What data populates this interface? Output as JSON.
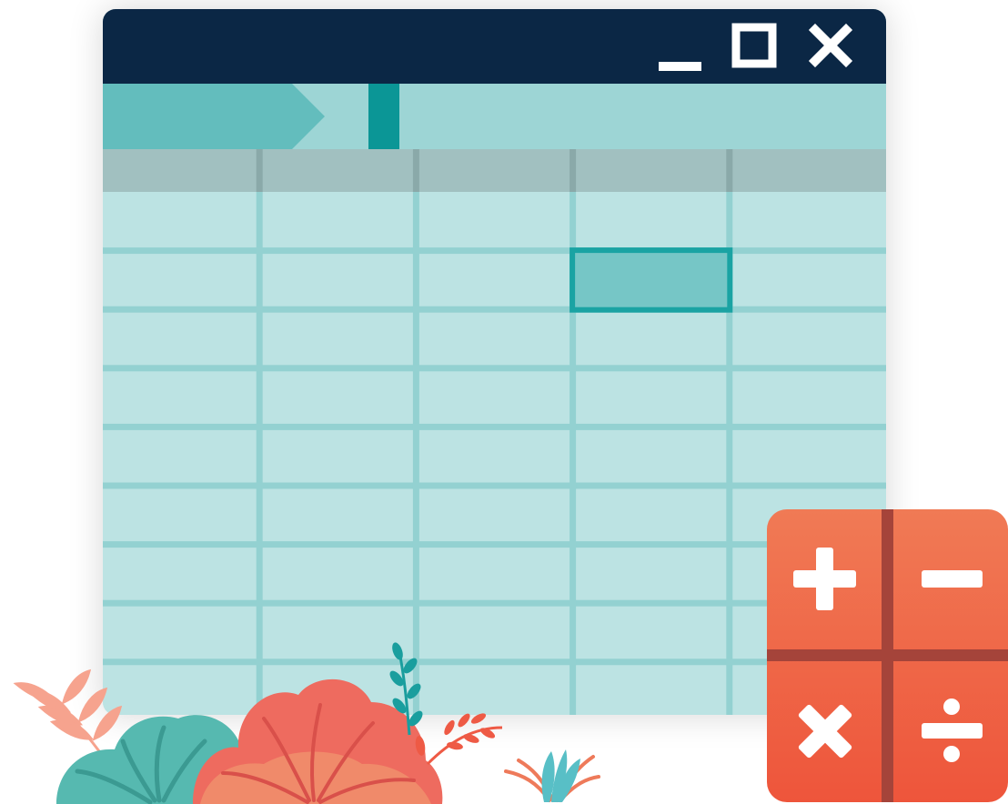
{
  "window": {
    "controls": [
      {
        "name": "minimize-button",
        "icon": "minimize-icon"
      },
      {
        "name": "maximize-button",
        "icon": "maximize-icon"
      },
      {
        "name": "close-button",
        "icon": "close-icon"
      }
    ]
  },
  "sheet": {
    "column_count": 5,
    "data_row_count": 9,
    "selected_cell": {
      "column": 4,
      "row": 2
    }
  },
  "calculator": {
    "operators": [
      "+",
      "−",
      "×",
      "÷"
    ]
  },
  "colors": {
    "titlebar": "#0b2745",
    "toolbar": "#9dd5d5",
    "breadcrumb": "#63bdbd",
    "cursor": "#0b9696",
    "header_row": "#a1c0c0",
    "cell": "#bce3e3",
    "grid_line": "#93d1d1",
    "selection": "#1aa3a3",
    "calc_top": "#f07a55",
    "calc_bottom": "#ee553b"
  }
}
